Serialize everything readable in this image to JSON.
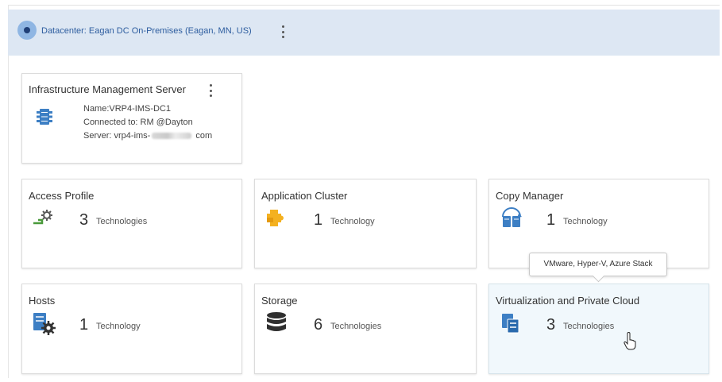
{
  "datacenter": {
    "label": "Datacenter: Eagan DC On-Premises (Eagan, MN, US)"
  },
  "ims_card": {
    "title": "Infrastructure Management Server",
    "name_line": "Name:VRP4-IMS-DC1",
    "connected_line": "Connected to: RM @Dayton",
    "server_prefix": "Server: vrp4-ims-",
    "server_suffix": "com"
  },
  "cards": [
    {
      "title": "Access Profile",
      "count": "3",
      "unit": "Technologies",
      "icon": "access-profile-icon"
    },
    {
      "title": "Application Cluster",
      "count": "1",
      "unit": "Technology",
      "icon": "puzzle-icon"
    },
    {
      "title": "Copy Manager",
      "count": "1",
      "unit": "Technology",
      "icon": "copy-manager-icon"
    },
    {
      "title": "Hosts",
      "count": "1",
      "unit": "Technology",
      "icon": "host-gear-icon"
    },
    {
      "title": "Storage",
      "count": "6",
      "unit": "Technologies",
      "icon": "database-icon"
    },
    {
      "title": "Virtualization and Private Cloud",
      "count": "3",
      "unit": "Technologies",
      "icon": "virtualization-icon"
    }
  ],
  "tooltip": {
    "text": "VMware, Hyper-V, Azure Stack"
  },
  "colors": {
    "header_bg": "#dde7f3",
    "link_blue": "#2d5d9f",
    "icon_blue": "#3d7fc4",
    "icon_orange": "#f4b120",
    "hover_card_bg": "#f1f8fc"
  }
}
